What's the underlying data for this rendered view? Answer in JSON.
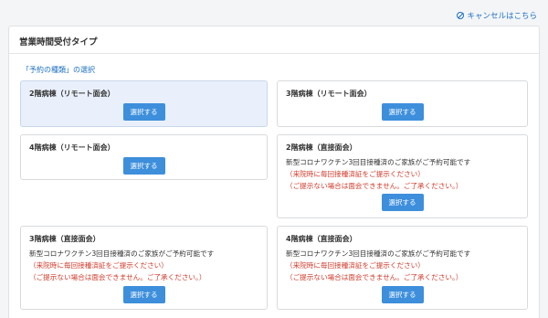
{
  "header": {
    "cancel_label": "キャンセルはこちら"
  },
  "panel": {
    "title": "営業時間受付タイプ",
    "section_label": "「予約の種類」の選択"
  },
  "cards": [
    {
      "title": "2階病棟（リモート面会）",
      "button": "選択する"
    },
    {
      "title": "3階病棟（リモート面会）",
      "button": "選択する"
    },
    {
      "title": "4階病棟（リモート面会）",
      "button": "選択する"
    },
    {
      "title": "2階病棟（直接面会）",
      "note": "新型コロナワクチン3回目接種済のご家族がご予約可能です",
      "warn1": "（来院時に毎回接種済証をご提示ください）",
      "warn2": "（ご提示ない場合は面会できません。ご了承ください。）",
      "button": "選択する"
    },
    {
      "title": "3階病棟（直接面会）",
      "note": "新型コロナワクチン3回目接種済のご家族がご予約可能です",
      "warn1": "（来院時に毎回接種済証をご提示ください）",
      "warn2": "（ご提示ない場合は面会できません。ご了承ください。）",
      "button": "選択する"
    },
    {
      "title": "4階病棟（直接面会）",
      "note": "新型コロナワクチン3回目接種済のご家族がご予約可能です",
      "warn1": "（来院時に毎回接種済証をご提示ください）",
      "warn2": "（ご提示ない場合は面会できません。ご了承ください。）",
      "button": "選択する"
    }
  ],
  "colors": {
    "link": "#1b6fc2",
    "button": "#3d8fdc",
    "warning": "#d13a2a",
    "selected_card": "#e9f0fb"
  }
}
